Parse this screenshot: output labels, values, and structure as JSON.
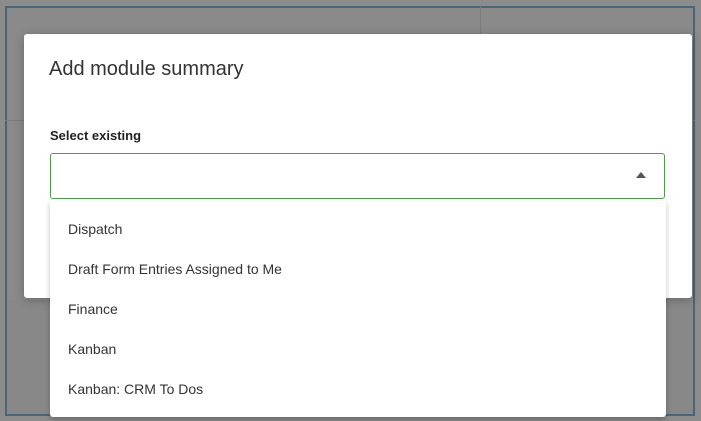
{
  "modal": {
    "title": "Add module summary",
    "field": {
      "label": "Select existing",
      "value": ""
    }
  },
  "dropdown": {
    "options": [
      {
        "label": "Dispatch"
      },
      {
        "label": "Draft Form Entries Assigned to Me"
      },
      {
        "label": "Finance"
      },
      {
        "label": "Kanban"
      },
      {
        "label": "Kanban: CRM To Dos"
      }
    ]
  },
  "colors": {
    "focus_border": "#4f9a4f",
    "backdrop": "#8c8c8c",
    "frame_border": "#4a6478"
  },
  "icons": {
    "select_caret": "chevron-up-icon"
  }
}
